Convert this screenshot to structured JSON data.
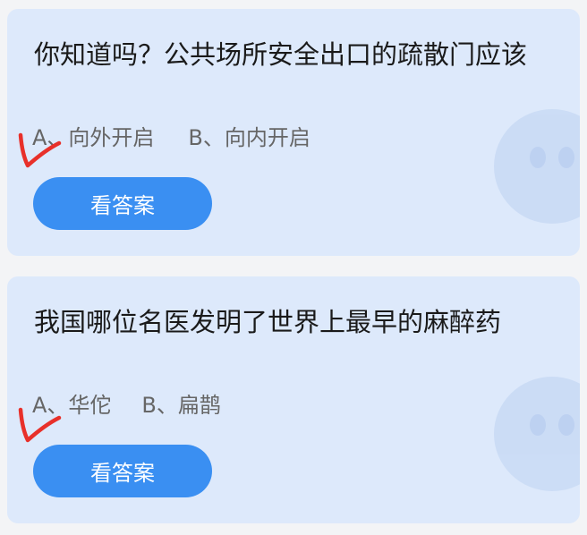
{
  "cards": [
    {
      "question": "你知道吗？公共场所安全出口的疏散门应该",
      "option_a": "A、向外开启",
      "option_b": "B、向内开启",
      "button_label": "看答案"
    },
    {
      "question": "我国哪位名医发明了世界上最早的麻醉药",
      "option_a": "A、华佗",
      "option_b": "B、扁鹊",
      "button_label": "看答案"
    }
  ],
  "colors": {
    "card_background": "#dde9fb",
    "button": "#3a8ff2",
    "checkmark": "#e8302a"
  },
  "icons": {
    "checkmark": "handwritten-checkmark-icon",
    "watermark": "mascot-watermark-icon"
  }
}
